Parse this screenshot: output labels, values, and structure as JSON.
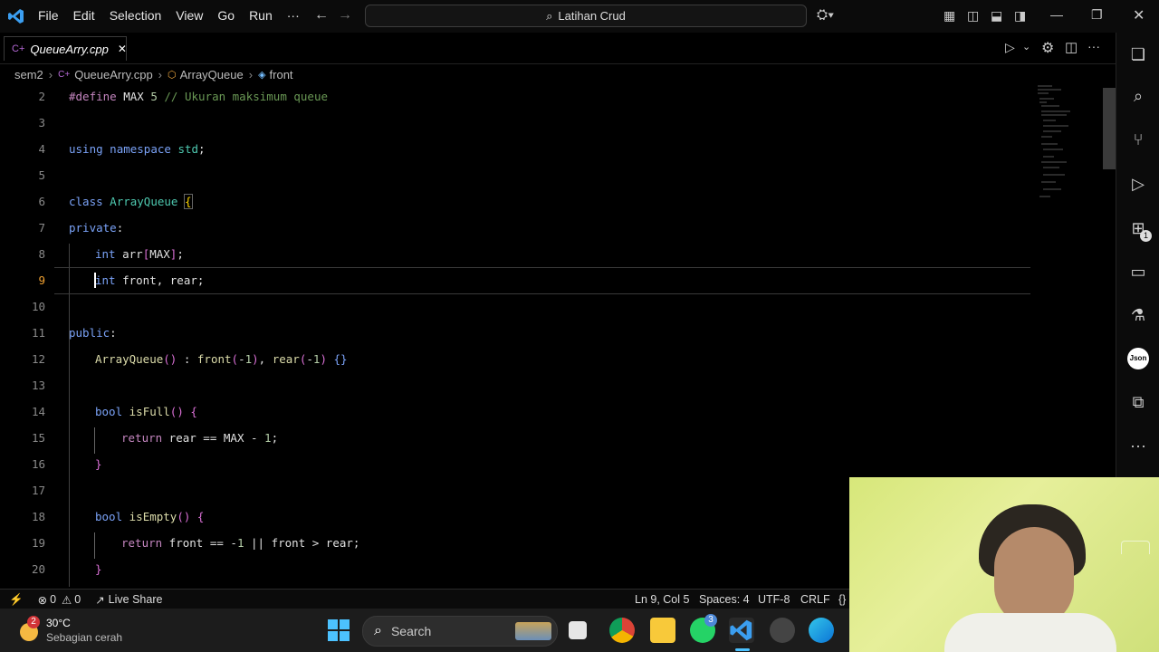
{
  "titlebar": {
    "menu": [
      "File",
      "Edit",
      "Selection",
      "View",
      "Go",
      "Run",
      "···"
    ],
    "search_text": "Latihan Crud"
  },
  "tab": {
    "label": "QueueArry.cpp",
    "close": "✕"
  },
  "breadcrumb": {
    "folder": "sem2",
    "file": "QueueArry.cpp",
    "class": "ArrayQueue",
    "member": "front"
  },
  "editor": {
    "active_line": 9,
    "line_numbers": [
      "2",
      "3",
      "4",
      "5",
      "6",
      "7",
      "8",
      "9",
      "10",
      "11",
      "12",
      "13",
      "14",
      "15",
      "16",
      "17",
      "18",
      "19",
      "20"
    ]
  },
  "status": {
    "errors": "0",
    "warnings": "0",
    "live_share": "Live Share",
    "position": "Ln 9, Col 5",
    "spaces": "Spaces: 4",
    "encoding": "UTF-8",
    "eol": "CRLF"
  },
  "taskbar": {
    "weather_badge": "2",
    "temperature": "30°C",
    "weather_desc": "Sebagian cerah",
    "search_label": "Search",
    "whatsapp_badge": "3"
  },
  "activity_bar": {
    "extensions_badge": "1",
    "json_label": "Json"
  }
}
